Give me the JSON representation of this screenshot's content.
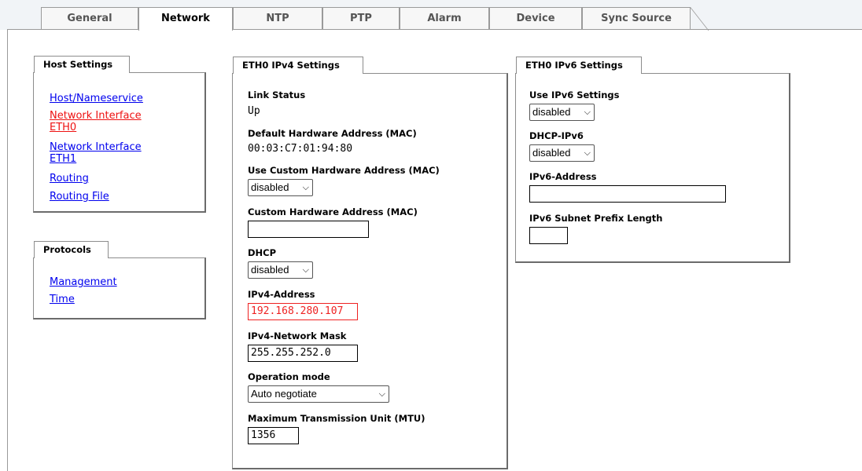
{
  "tabs": [
    {
      "label": "General"
    },
    {
      "label": "Network"
    },
    {
      "label": "NTP"
    },
    {
      "label": "PTP"
    },
    {
      "label": "Alarm"
    },
    {
      "label": "Device"
    },
    {
      "label": "Sync Source"
    }
  ],
  "active_tab": "Network",
  "host_settings": {
    "title": "Host Settings",
    "links": [
      {
        "label": "Host/Nameservice",
        "current": false
      },
      {
        "label": "Network Interface ETH0",
        "current": true
      },
      {
        "label": "Network Interface ETH1",
        "current": false
      },
      {
        "label": "Routing",
        "current": false
      },
      {
        "label": "Routing File",
        "current": false
      }
    ]
  },
  "protocols": {
    "title": "Protocols",
    "links": [
      {
        "label": "Management"
      },
      {
        "label": "Time"
      }
    ]
  },
  "ipv4": {
    "title": "ETH0 IPv4 Settings",
    "link_status_label": "Link Status",
    "link_status_value": "Up",
    "default_mac_label": "Default Hardware Address (MAC)",
    "default_mac_value": "00:03:C7:01:94:80",
    "use_custom_mac_label": "Use Custom Hardware Address (MAC)",
    "use_custom_mac_value": "disabled",
    "custom_mac_label": "Custom Hardware Address (MAC)",
    "custom_mac_value": "",
    "dhcp_label": "DHCP",
    "dhcp_value": "disabled",
    "ipv4_address_label": "IPv4-Address",
    "ipv4_address_value": "192.168.280.107",
    "netmask_label": "IPv4-Network Mask",
    "netmask_value": "255.255.252.0",
    "operation_mode_label": "Operation mode",
    "operation_mode_value": "Auto negotiate",
    "mtu_label": "Maximum Transmission Unit (MTU)",
    "mtu_value": "1356"
  },
  "ipv6": {
    "title": "ETH0 IPv6 Settings",
    "use_ipv6_label": "Use IPv6 Settings",
    "use_ipv6_value": "disabled",
    "dhcp_ipv6_label": "DHCP-IPv6",
    "dhcp_ipv6_value": "disabled",
    "ipv6_address_label": "IPv6-Address",
    "ipv6_address_value": "",
    "prefix_label": "IPv6 Subnet Prefix Length",
    "prefix_value": ""
  },
  "icons": {
    "select_caret": "chevron-down-icon"
  },
  "colors": {
    "link": "#0000ee",
    "current_link": "#ee1111",
    "error": "#ee2222",
    "tabbar_bg": "#f1f4f7"
  }
}
